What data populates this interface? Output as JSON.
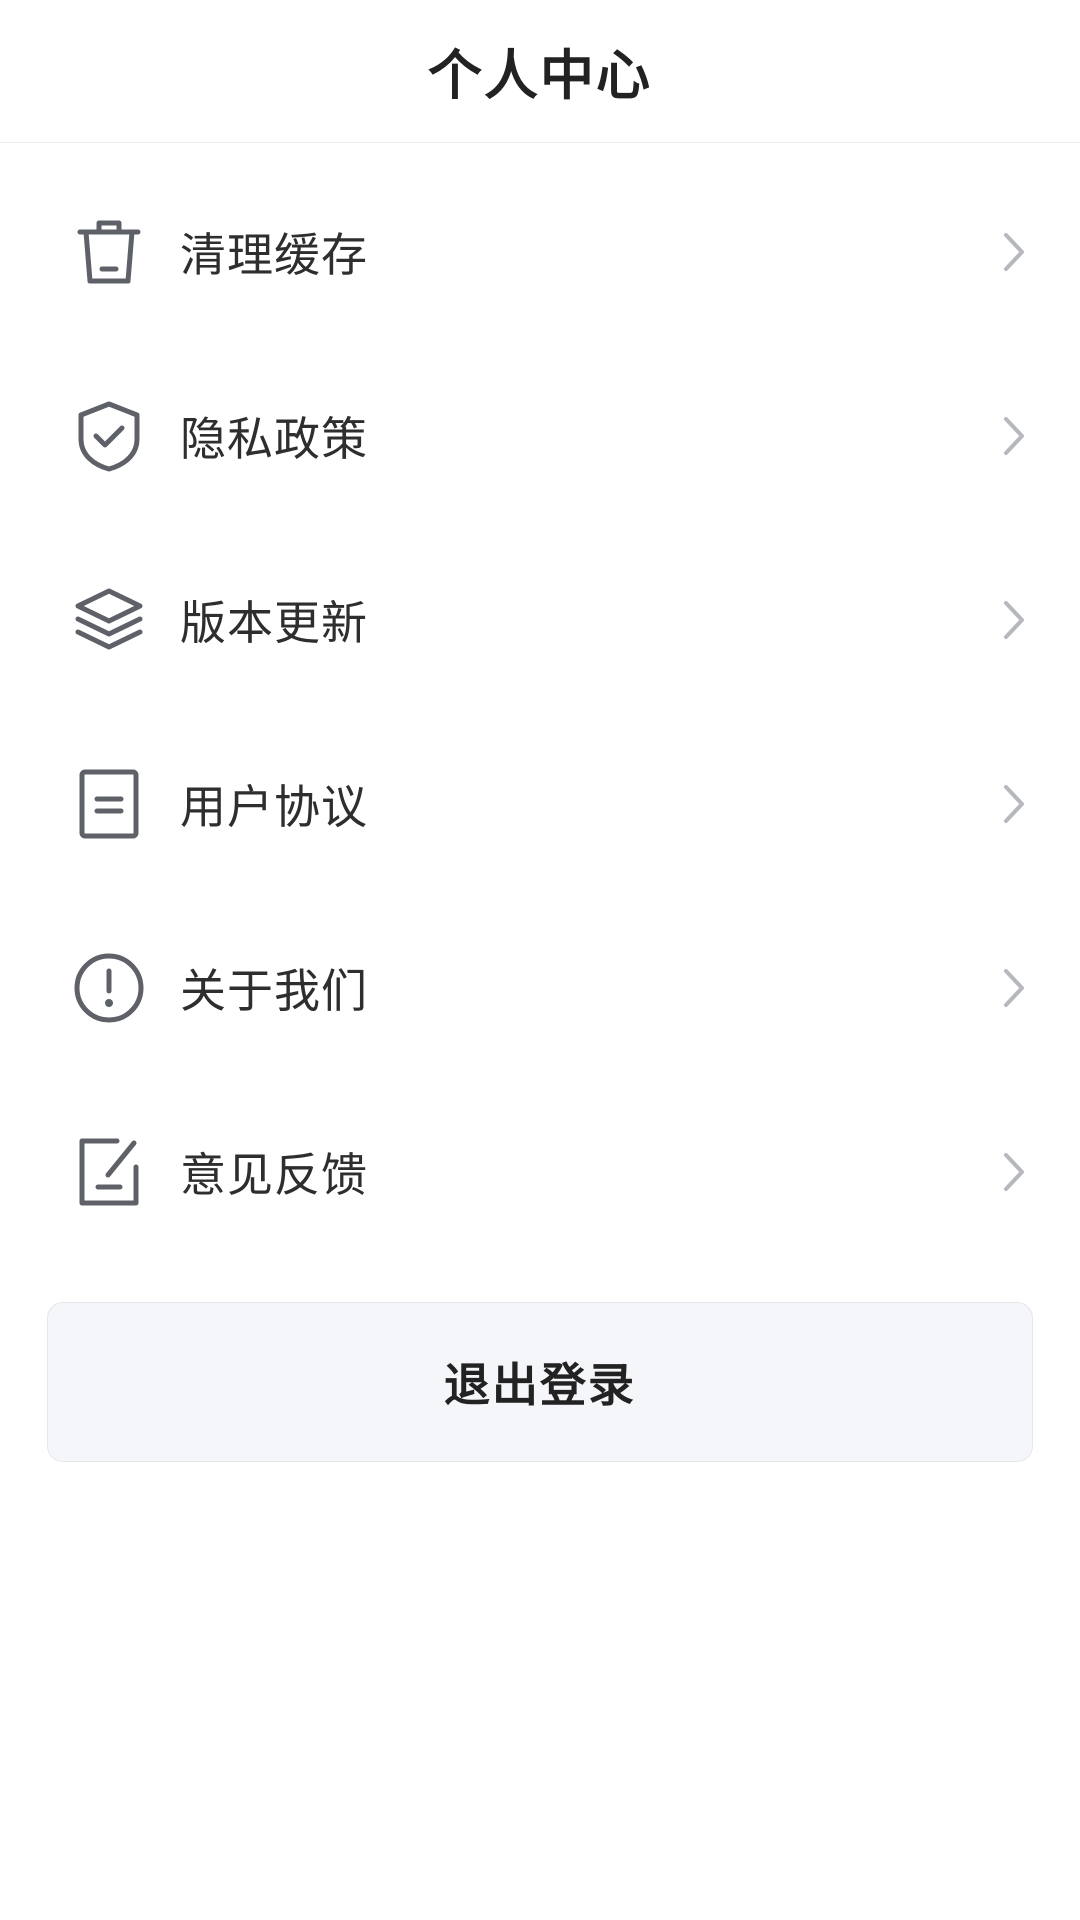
{
  "header": {
    "title": "个人中心"
  },
  "menu": {
    "items": [
      {
        "label": "清理缓存",
        "icon": "trash-icon"
      },
      {
        "label": "隐私政策",
        "icon": "shield-check-icon"
      },
      {
        "label": "版本更新",
        "icon": "layers-icon"
      },
      {
        "label": "用户协议",
        "icon": "document-icon"
      },
      {
        "label": "关于我们",
        "icon": "info-circle-icon"
      },
      {
        "label": "意见反馈",
        "icon": "edit-note-icon"
      }
    ]
  },
  "logout": {
    "label": "退出登录"
  },
  "colors": {
    "icon": "#5f6168",
    "chevron": "#b6b8bf",
    "logout_bg": "#f5f6fa",
    "text": "#2e2e2e"
  }
}
